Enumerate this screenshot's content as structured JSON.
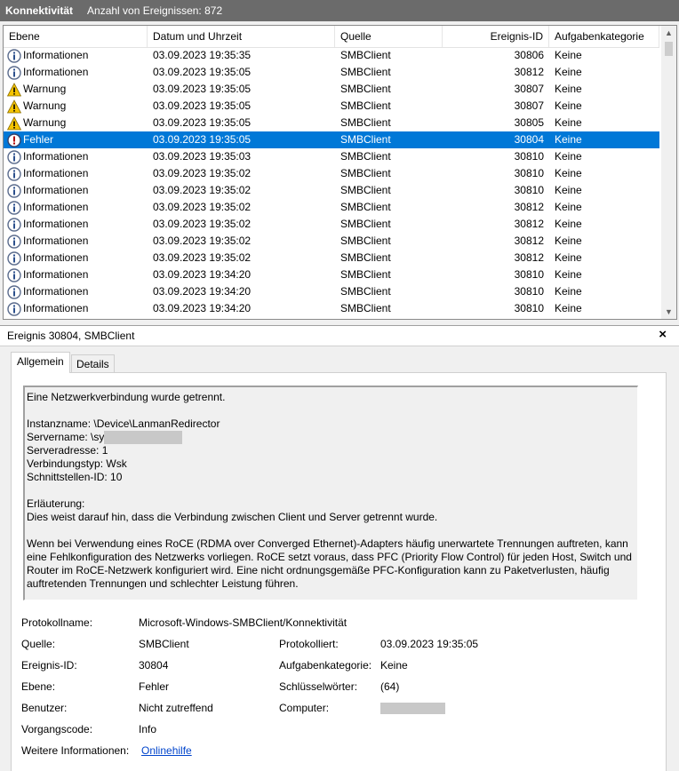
{
  "titlebar": {
    "log": "Konnektivität",
    "count": "Anzahl von Ereignissen: 872"
  },
  "columns": [
    "Ebene",
    "Datum und Uhrzeit",
    "Quelle",
    "Ereignis-ID",
    "Aufgabenkategorie"
  ],
  "events": [
    {
      "level": "Informationen",
      "icon": "info",
      "date": "03.09.2023 19:35:35",
      "source": "SMBClient",
      "id": "30806",
      "category": "Keine"
    },
    {
      "level": "Informationen",
      "icon": "info",
      "date": "03.09.2023 19:35:05",
      "source": "SMBClient",
      "id": "30812",
      "category": "Keine"
    },
    {
      "level": "Warnung",
      "icon": "warning",
      "date": "03.09.2023 19:35:05",
      "source": "SMBClient",
      "id": "30807",
      "category": "Keine"
    },
    {
      "level": "Warnung",
      "icon": "warning",
      "date": "03.09.2023 19:35:05",
      "source": "SMBClient",
      "id": "30807",
      "category": "Keine"
    },
    {
      "level": "Warnung",
      "icon": "warning",
      "date": "03.09.2023 19:35:05",
      "source": "SMBClient",
      "id": "30805",
      "category": "Keine"
    },
    {
      "level": "Fehler",
      "icon": "error",
      "date": "03.09.2023 19:35:05",
      "source": "SMBClient",
      "id": "30804",
      "category": "Keine",
      "selected": true
    },
    {
      "level": "Informationen",
      "icon": "info",
      "date": "03.09.2023 19:35:03",
      "source": "SMBClient",
      "id": "30810",
      "category": "Keine"
    },
    {
      "level": "Informationen",
      "icon": "info",
      "date": "03.09.2023 19:35:02",
      "source": "SMBClient",
      "id": "30810",
      "category": "Keine"
    },
    {
      "level": "Informationen",
      "icon": "info",
      "date": "03.09.2023 19:35:02",
      "source": "SMBClient",
      "id": "30810",
      "category": "Keine"
    },
    {
      "level": "Informationen",
      "icon": "info",
      "date": "03.09.2023 19:35:02",
      "source": "SMBClient",
      "id": "30812",
      "category": "Keine"
    },
    {
      "level": "Informationen",
      "icon": "info",
      "date": "03.09.2023 19:35:02",
      "source": "SMBClient",
      "id": "30812",
      "category": "Keine"
    },
    {
      "level": "Informationen",
      "icon": "info",
      "date": "03.09.2023 19:35:02",
      "source": "SMBClient",
      "id": "30812",
      "category": "Keine"
    },
    {
      "level": "Informationen",
      "icon": "info",
      "date": "03.09.2023 19:35:02",
      "source": "SMBClient",
      "id": "30812",
      "category": "Keine"
    },
    {
      "level": "Informationen",
      "icon": "info",
      "date": "03.09.2023 19:34:20",
      "source": "SMBClient",
      "id": "30810",
      "category": "Keine"
    },
    {
      "level": "Informationen",
      "icon": "info",
      "date": "03.09.2023 19:34:20",
      "source": "SMBClient",
      "id": "30810",
      "category": "Keine"
    },
    {
      "level": "Informationen",
      "icon": "info",
      "date": "03.09.2023 19:34:20",
      "source": "SMBClient",
      "id": "30810",
      "category": "Keine"
    }
  ],
  "detail": {
    "title": "Ereignis 30804, SMBClient",
    "close": "×",
    "tabs": {
      "general": "Allgemein",
      "details": "Details"
    },
    "description": {
      "line1": "Eine Netzwerkverbindung wurde getrennt.",
      "instance": "Instanzname: \\Device\\LanmanRedirector",
      "server_name": "Servername: \\sy",
      "server_addr": "Serveradresse: 1",
      "conn_type": "Verbindungstyp: Wsk",
      "iface": "Schnittstellen-ID: 10",
      "expl_label": "Erläuterung:",
      "expl": "Dies weist darauf hin, dass die Verbindung zwischen Client und Server getrennt wurde.",
      "p1": "Wenn bei Verwendung eines RoCE (RDMA over Converged Ethernet)-Adapters häufig unerwartete Trennungen auftreten, kann",
      "p2": "eine Fehlkonfiguration des Netzwerks vorliegen. RoCE setzt voraus, dass PFC (Priority Flow Control) für jeden Host, Switch und",
      "p3": "Router im RoCE-Netzwerk konfiguriert wird. Eine nicht ordnungsgemäße PFC-Konfiguration kann zu Paketverlusten, häufig",
      "p4": "auftretenden Trennungen und schlechter Leistung führen."
    },
    "props": {
      "log_name_label": "Protokollname:",
      "log_name": "Microsoft-Windows-SMBClient/Konnektivität",
      "source_label": "Quelle:",
      "source": "SMBClient",
      "logged_label": "Protokolliert:",
      "logged": "03.09.2023 19:35:05",
      "id_label": "Ereignis-ID:",
      "id": "30804",
      "task_label": "Aufgabenkategorie:",
      "task": "Keine",
      "level_label": "Ebene:",
      "level": "Fehler",
      "keywords_label": "Schlüsselwörter:",
      "keywords": "(64)",
      "user_label": "Benutzer:",
      "user": "Nicht zutreffend",
      "computer_label": "Computer:",
      "opcode_label": "Vorgangscode:",
      "opcode": "Info",
      "more_label": "Weitere Informationen:",
      "more_link": "Onlinehilfe"
    }
  },
  "colors": {
    "selection": "#0078d7",
    "warning": "#f5c400",
    "info_ring": "#5a6b8c",
    "link": "#0044cc"
  }
}
